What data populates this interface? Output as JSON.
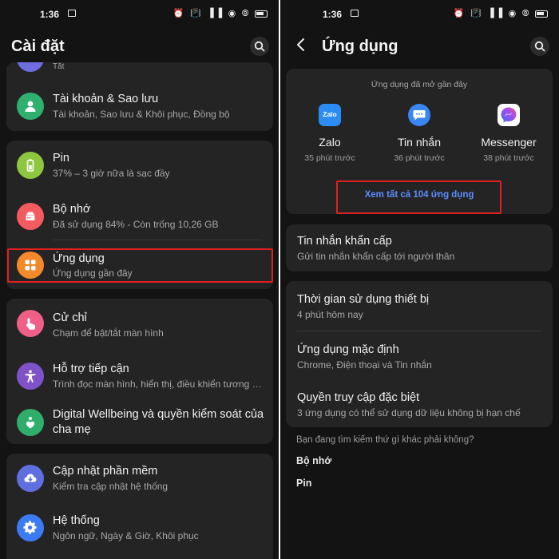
{
  "left": {
    "status": {
      "time": "1:36"
    },
    "title": "Cài đặt",
    "partial_item": {
      "subtitle": "Tắt"
    },
    "items": [
      {
        "title": "Tài khoản & Sao lưu",
        "subtitle": "Tài khoản, Sao lưu & Khôi phục, Đồng bộ",
        "icon": "account-icon",
        "color": "#2fb06f"
      },
      {
        "title": "Pin",
        "subtitle": "37% – 3 giờ nữa là sạc đầy",
        "icon": "battery-icon",
        "color": "#8ec63f"
      },
      {
        "title": "Bộ nhớ",
        "subtitle": "Đã sử dụng 84% - Còn trống 10,26 GB",
        "icon": "storage-icon",
        "color": "#f45b61"
      },
      {
        "title": "Ứng dụng",
        "subtitle": "Ứng dụng gần đây",
        "icon": "apps-icon",
        "color": "#f2892b"
      },
      {
        "title": "Cử chỉ",
        "subtitle": "Chạm để bật/tắt màn hình",
        "icon": "gesture-icon",
        "color": "#ef5f86"
      },
      {
        "title": "Hỗ trợ tiếp cận",
        "subtitle": "Trình đọc màn hình, hiển thị, điều khiển tương t...",
        "icon": "accessibility-icon",
        "color": "#7f53c7"
      },
      {
        "title": "Digital Wellbeing và quyền kiểm soát của",
        "title2": "cha mẹ",
        "icon": "wellbeing-icon",
        "color": "#2fae6b"
      },
      {
        "title": "Cập nhật phần mềm",
        "subtitle": "Kiểm tra cập nhật hệ thống",
        "icon": "update-icon",
        "color": "#5f6fe0"
      },
      {
        "title": "Hệ thống",
        "subtitle": "Ngôn ngữ, Ngày & Giờ, Khôi phục",
        "icon": "system-icon",
        "color": "#3b7cf4"
      }
    ]
  },
  "right": {
    "status": {
      "time": "1:36"
    },
    "title": "Ứng dụng",
    "recent_label": "Ứng dụng đã mở gần đây",
    "recent_apps": [
      {
        "name": "Zalo",
        "time": "35 phút trước",
        "icon": "zalo-icon",
        "color": "#2b8cf3",
        "glyph": "Zalo"
      },
      {
        "name": "Tin nhắn",
        "time": "36 phút trước",
        "icon": "messages-icon",
        "color": "#3a86f5"
      },
      {
        "name": "Messenger",
        "time": "38 phút trước",
        "icon": "messenger-icon",
        "color": "#a24df0"
      }
    ],
    "see_all": "Xem tất cả 104 ứng dụng",
    "emergency": {
      "title": "Tin nhắn khẩn cấp",
      "subtitle": "Gửi tin nhắn khẩn cấp tới người thân"
    },
    "group": [
      {
        "title": "Thời gian sử dụng thiết bị",
        "subtitle": "4 phút hôm nay"
      },
      {
        "title": "Ứng dụng mặc định",
        "subtitle": "Chrome, Điện thoại và Tin nhắn"
      },
      {
        "title": "Quyền truy cập đặc biệt",
        "subtitle": "3 ứng dụng có thể sử dụng dữ liệu không bị hạn chế"
      }
    ],
    "suggest": {
      "title": "Bạn đang tìm kiếm thứ gì khác phải không?",
      "links": [
        "Bộ nhớ",
        "Pin"
      ]
    }
  },
  "colors": {
    "background": "#131313",
    "card": "#242424",
    "accent": "#5d8dff",
    "highlight": "#e02020"
  }
}
